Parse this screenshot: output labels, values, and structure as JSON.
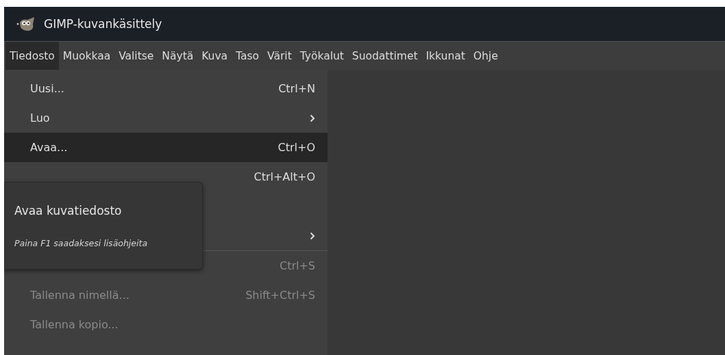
{
  "window": {
    "title": "GIMP-kuvankäsittely"
  },
  "menubar": [
    {
      "label": "Tiedosto",
      "selected": true
    },
    {
      "label": "Muokkaa",
      "selected": false
    },
    {
      "label": "Valitse",
      "selected": false
    },
    {
      "label": "Näytä",
      "selected": false
    },
    {
      "label": "Kuva",
      "selected": false
    },
    {
      "label": "Taso",
      "selected": false
    },
    {
      "label": "Värit",
      "selected": false
    },
    {
      "label": "Työkalut",
      "selected": false
    },
    {
      "label": "Suodattimet",
      "selected": false
    },
    {
      "label": "Ikkunat",
      "selected": false
    },
    {
      "label": "Ohje",
      "selected": false
    }
  ],
  "menu": {
    "items": [
      {
        "kind": "command",
        "label": "Uusi...",
        "shortcut": "Ctrl+N",
        "selected": false,
        "disabled": false
      },
      {
        "kind": "submenu",
        "label": "Luo",
        "selected": false,
        "disabled": false
      },
      {
        "kind": "command",
        "label": "Avaa...",
        "shortcut": "Ctrl+O",
        "selected": true,
        "disabled": false
      },
      {
        "kind": "command",
        "shortcut": "Ctrl+Alt+O",
        "selected": false,
        "disabled": false
      },
      {
        "kind": "command",
        "selected": false
      },
      {
        "kind": "submenu",
        "selected": false
      },
      {
        "kind": "separator"
      },
      {
        "kind": "command",
        "shortcut": "Ctrl+S",
        "selected": false,
        "disabled": true
      },
      {
        "kind": "command",
        "label": "Tallenna nimellä...",
        "shortcut": "Shift+Ctrl+S",
        "selected": false,
        "disabled": true
      },
      {
        "kind": "command",
        "label": "Tallenna kopio...",
        "selected": false,
        "disabled": true
      }
    ]
  },
  "tooltip": {
    "title": "Avaa kuvatiedosto",
    "hint": "Paina F1 saadaksesi lisäohjeita"
  }
}
